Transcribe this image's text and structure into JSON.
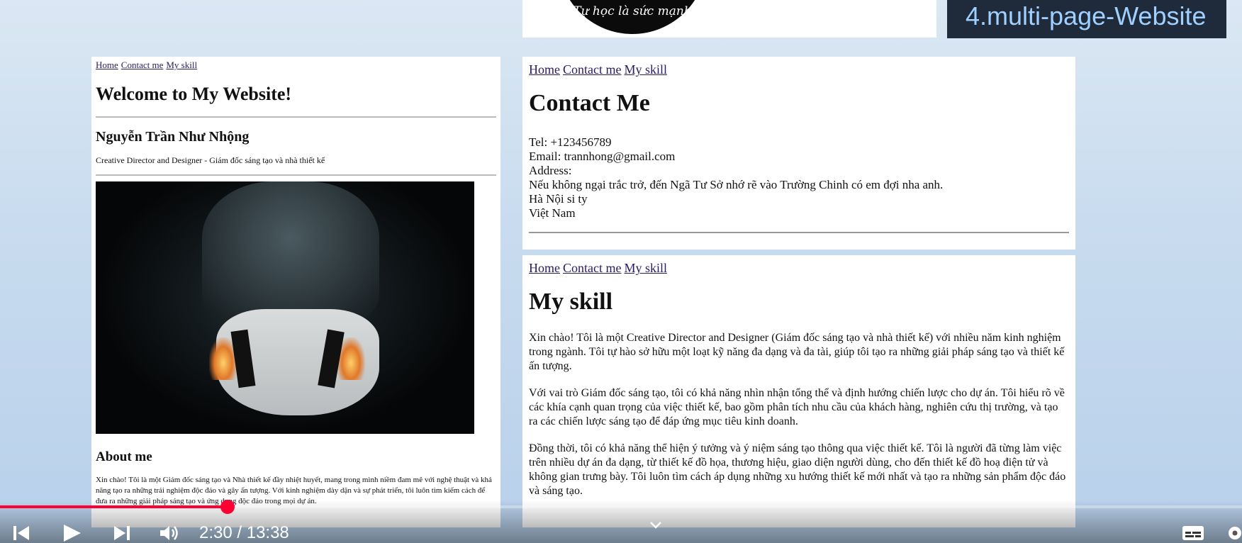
{
  "top": {
    "logo_text": "Tự học là sức mạnh",
    "video_title": "4.multi-page-Website"
  },
  "left": {
    "nav": [
      "Home",
      "Contact me",
      "My skill"
    ],
    "welcome": "Welcome to My Website!",
    "name": "Nguyễn Trần Như Nhộng",
    "role": "Creative Director and Designer - Giám đốc sáng tạo và nhà thiết kế",
    "about_heading": "About me",
    "about_text": "Xin chào! Tôi là một Giám đốc sáng tạo và Nhà thiết kế đầy nhiệt huyết, mang trong mình niềm đam mê với nghệ thuật và khả năng tạo ra những trải nghiệm độc đáo và gây ấn tượng. Với kinh nghiệm dày dặn và sự phát triển, tôi luôn tìm kiếm cách để đưa ra những giải pháp sáng tạo và ứng dụng độc đáo trong mọi dự án."
  },
  "contact": {
    "nav": [
      "Home",
      "Contact me",
      "My skill"
    ],
    "heading": "Contact Me",
    "tel": "Tel: +123456789",
    "email": "Email: trannhong@gmail.com",
    "address_label": "Address:",
    "address_line1": "Nếu không ngại trắc trở, đến Ngã Tư Sở nhớ rẽ vào Trường Chinh có em đợi nha anh.",
    "address_line2": "Hà Nội si ty",
    "address_line3": "Việt Nam"
  },
  "skill": {
    "nav": [
      "Home",
      "Contact me",
      "My skill"
    ],
    "heading": "My skill",
    "p1": "Xin chào! Tôi là một Creative Director and Designer (Giám đốc sáng tạo và nhà thiết kế) với nhiều năm kinh nghiệm trong ngành. Tôi tự hào sở hữu một loạt kỹ năng đa dạng và đa tài, giúp tôi tạo ra những giải pháp sáng tạo và thiết kế ấn tượng.",
    "p2": "Với vai trò Giám đốc sáng tạo, tôi có khả năng nhìn nhận tổng thể và định hướng chiến lược cho dự án. Tôi hiểu rõ về các khía cạnh quan trọng của việc thiết kế, bao gồm phân tích nhu cầu của khách hàng, nghiên cứu thị trường, và tạo ra các chiến lược sáng tạo để đáp ứng mục tiêu kinh doanh.",
    "p3": "Đồng thời, tôi có khả năng thể hiện ý tưởng và ý niệm sáng tạo thông qua việc thiết kế. Tôi là người đã từng làm việc trên nhiều dự án đa dạng, từ thiết kế đồ họa, thương hiệu, giao diện người dùng, cho đến thiết kế đồ hoạ điện tử và không gian trưng bày. Tôi luôn tìm cách áp dụng những xu hướng thiết kế mới nhất và tạo ra những sản phẩm độc đáo và sáng tạo."
  },
  "player": {
    "time": "2:30 / 13:38",
    "progress": 0.1834,
    "accent_color": "#ff0033",
    "icons": [
      "previous-icon",
      "play-icon",
      "next-icon",
      "volume-icon",
      "chevron-down-icon",
      "subtitles-icon",
      "settings-icon"
    ]
  }
}
